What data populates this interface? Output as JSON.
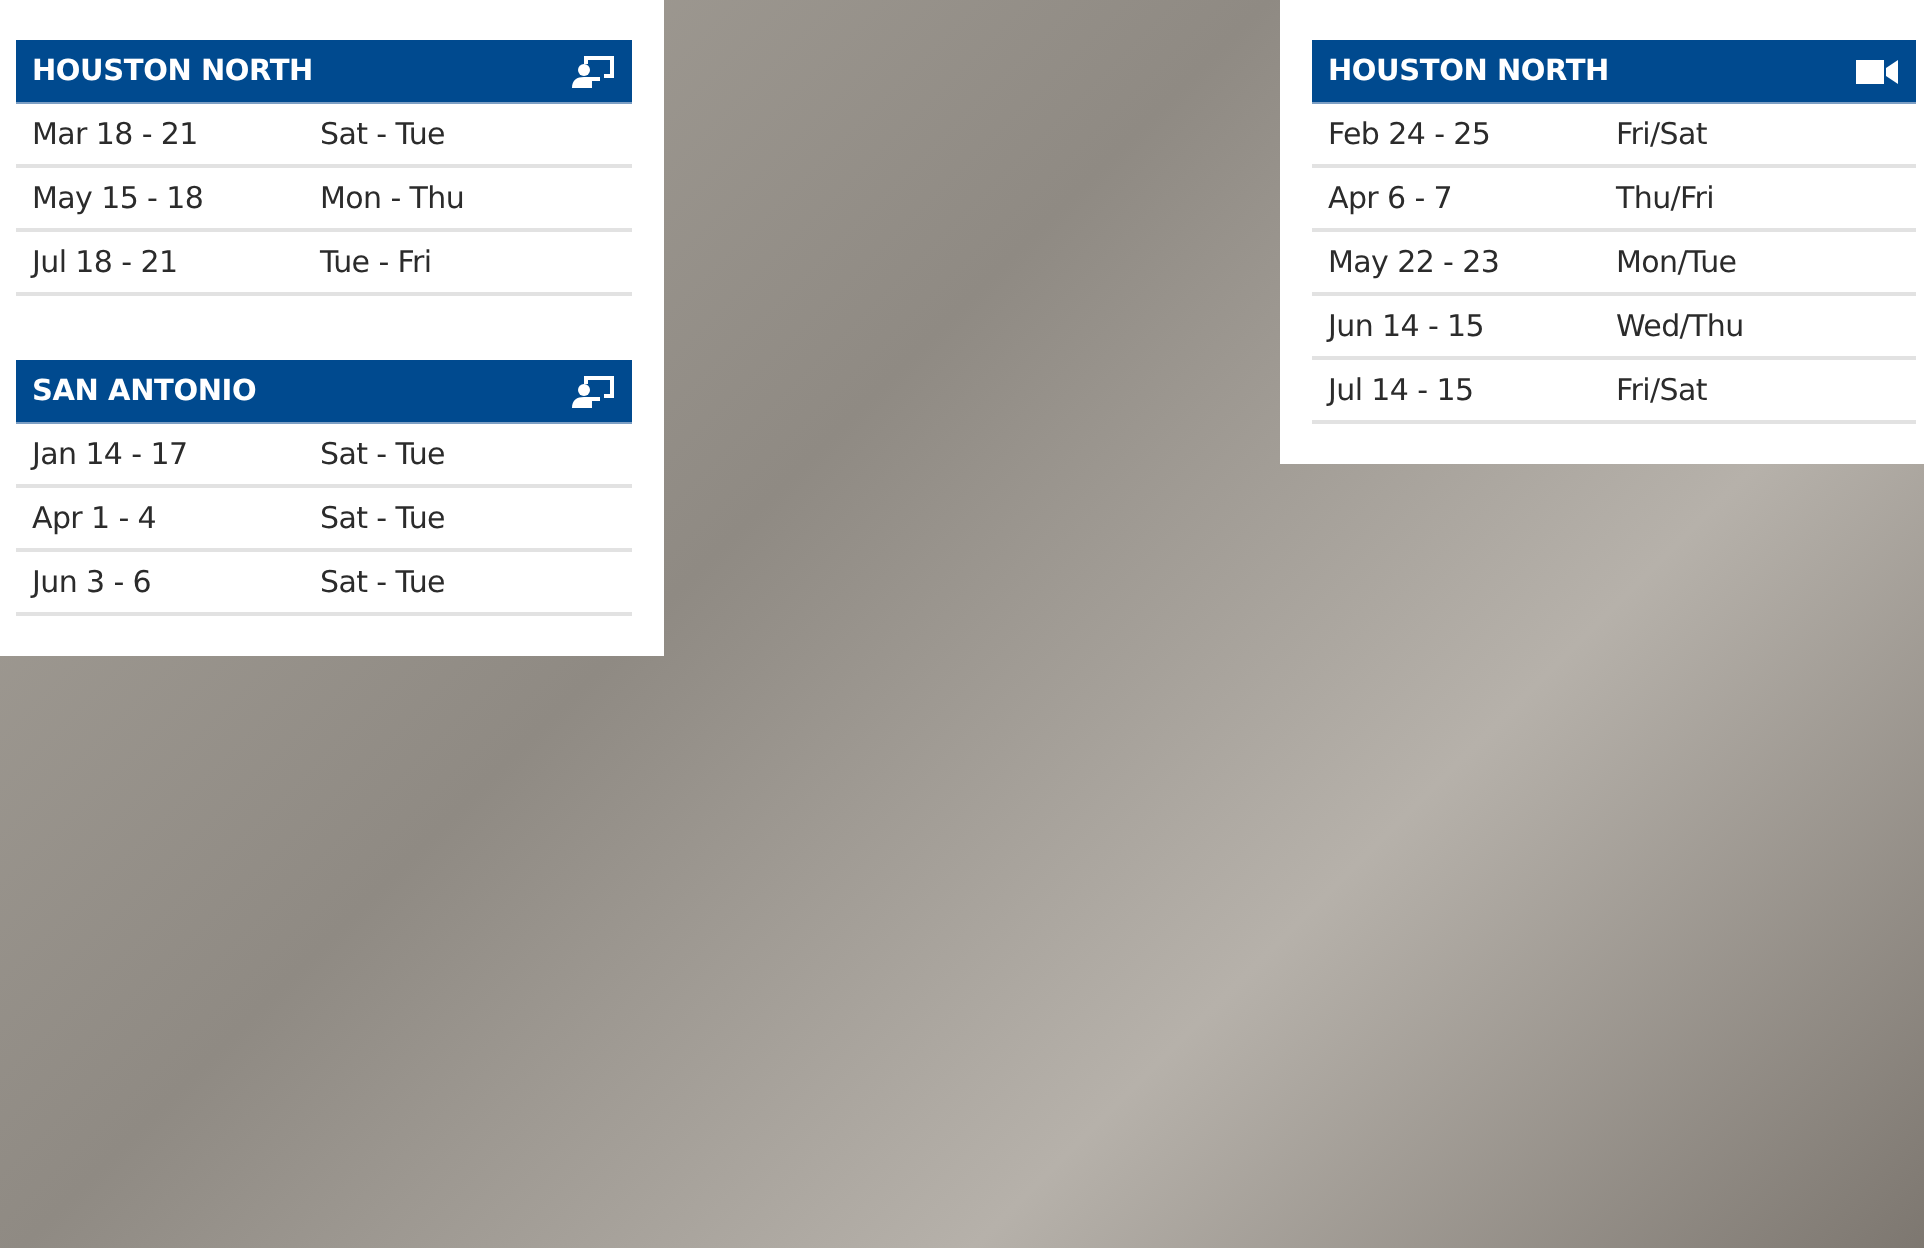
{
  "panels": [
    {
      "schedules": [
        {
          "title": "HOUSTON NORTH",
          "kind": "classroom",
          "rows": [
            {
              "dates": "Mar 18 - 21",
              "days": "Sat - Tue"
            },
            {
              "dates": "May 15 - 18",
              "days": "Mon - Thu"
            },
            {
              "dates": "Jul 18 - 21",
              "days": "Tue - Fri"
            }
          ]
        },
        {
          "title": "SAN ANTONIO",
          "kind": "classroom",
          "rows": [
            {
              "dates": "Jan 14 - 17",
              "days": "Sat - Tue"
            },
            {
              "dates": "Apr 1 - 4",
              "days": "Sat - Tue"
            },
            {
              "dates": "Jun 3 - 6",
              "days": "Sat - Tue"
            }
          ]
        }
      ]
    },
    {
      "schedules": [
        {
          "title": "HOUSTON NORTH",
          "kind": "video",
          "rows": [
            {
              "dates": "Feb 24 - 25",
              "days": "Fri/Sat"
            },
            {
              "dates": "Apr 6 - 7",
              "days": "Thu/Fri"
            },
            {
              "dates": "May 22 - 23",
              "days": "Mon/Tue"
            },
            {
              "dates": "Jun 14 - 15",
              "days": "Wed/Thu"
            },
            {
              "dates": "Jul 14 - 15",
              "days": "Fri/Sat"
            }
          ]
        }
      ]
    }
  ]
}
